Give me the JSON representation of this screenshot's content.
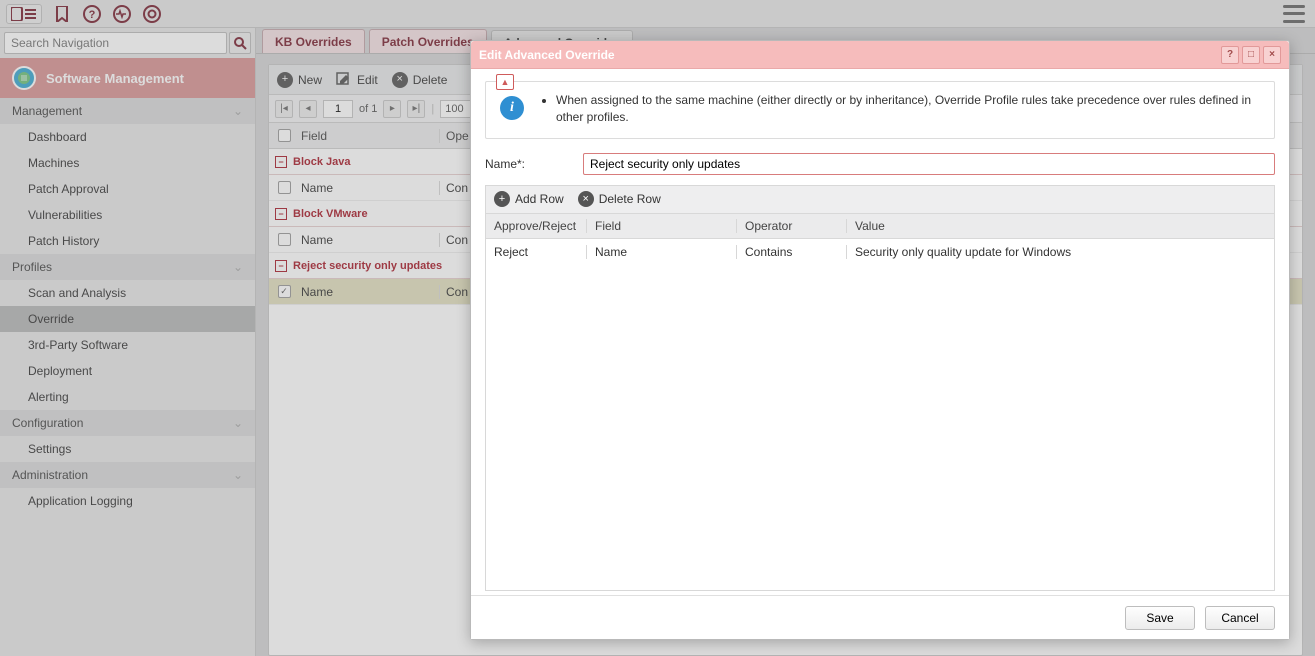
{
  "topbar": {},
  "sidebar": {
    "search_placeholder": "Search Navigation",
    "module_title": "Software Management",
    "groups": [
      {
        "label": "Management",
        "items": [
          "Dashboard",
          "Machines",
          "Patch Approval",
          "Vulnerabilities",
          "Patch History"
        ]
      },
      {
        "label": "Profiles",
        "items": [
          "Scan and Analysis",
          "Override",
          "3rd-Party Software",
          "Deployment",
          "Alerting"
        ],
        "selected": "Override"
      },
      {
        "label": "Configuration",
        "items": [
          "Settings"
        ]
      },
      {
        "label": "Administration",
        "items": [
          "Application Logging"
        ]
      }
    ]
  },
  "tabs": {
    "items": [
      "KB Overrides",
      "Patch Overrides",
      "Advanced Overrides"
    ],
    "active": "Advanced Overrides"
  },
  "toolbar": {
    "new_label": "New",
    "edit_label": "Edit",
    "delete_label": "Delete"
  },
  "pager": {
    "page": "1",
    "of_label": "of 1",
    "page_size": "100"
  },
  "grid": {
    "col_field": "Field",
    "col_op": "Ope",
    "groups": [
      {
        "name": "Block Java",
        "rows": [
          {
            "field": "Name",
            "op": "Con",
            "checked": false
          }
        ]
      },
      {
        "name": "Block VMware",
        "rows": [
          {
            "field": "Name",
            "op": "Con",
            "checked": false
          }
        ]
      },
      {
        "name": "Reject security only updates",
        "rows": [
          {
            "field": "Name",
            "op": "Con",
            "checked": true
          }
        ]
      }
    ]
  },
  "dialog": {
    "title": "Edit Advanced Override",
    "info_text": "When assigned to the same machine (either directly or by inheritance), Override Profile rules take precedence over rules defined in other profiles.",
    "name_label": "Name*:",
    "name_value": "Reject security only updates",
    "addrow_label": "Add Row",
    "delrow_label": "Delete Row",
    "cols": {
      "approve": "Approve/Reject",
      "field": "Field",
      "operator": "Operator",
      "value": "Value"
    },
    "rules": [
      {
        "approve": "Reject",
        "field": "Name",
        "operator": "Contains",
        "value": "Security only quality update for Windows"
      }
    ],
    "save_label": "Save",
    "cancel_label": "Cancel"
  }
}
